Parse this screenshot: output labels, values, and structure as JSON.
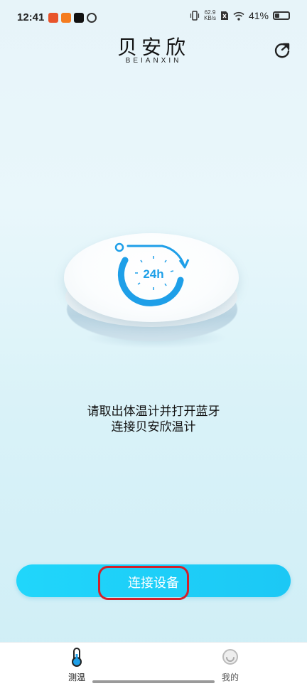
{
  "status_bar": {
    "time": "12:41",
    "net_speed_value": "62.9",
    "net_speed_unit": "KB/s",
    "battery_text": "41%",
    "battery_level": 0.41
  },
  "header": {
    "logo_cn": "贝安欣",
    "logo_en": "BEIANXIN"
  },
  "illustration": {
    "badge": "24h"
  },
  "message": {
    "line1": "请取出体温计并打开蓝牙",
    "line2": "连接贝安欣温计"
  },
  "connect_button": {
    "label": "连接设备"
  },
  "nav": {
    "items": [
      {
        "label": "测温",
        "icon": "thermometer-icon"
      },
      {
        "label": "我的",
        "icon": "smiley-icon"
      }
    ]
  },
  "colors": {
    "accent": "#1cc8f5",
    "highlight": "#d3202a"
  }
}
